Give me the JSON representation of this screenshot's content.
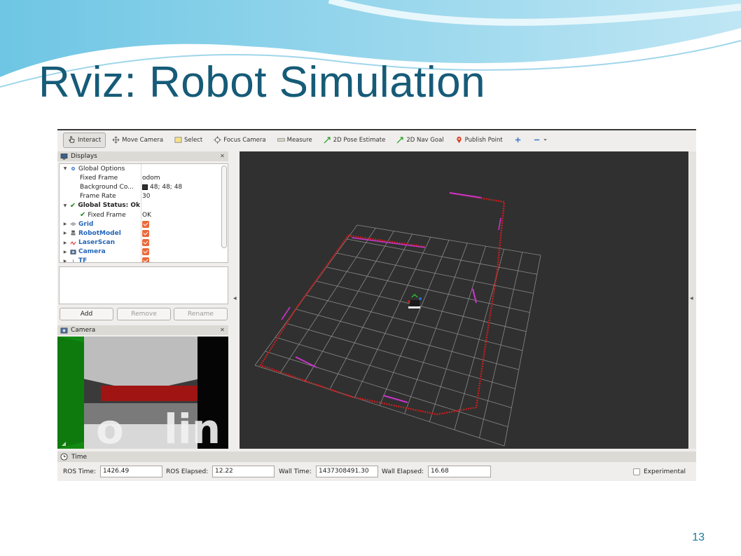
{
  "slide": {
    "title": "Rviz: Robot Simulation",
    "page_number": "13"
  },
  "toolbar": {
    "items": [
      {
        "label": "Interact",
        "icon": "hand-pointer-icon",
        "active": true
      },
      {
        "label": "Move Camera",
        "icon": "move-arrows-icon"
      },
      {
        "label": "Select",
        "icon": "select-rectangle-icon"
      },
      {
        "label": "Focus Camera",
        "icon": "focus-crosshair-icon"
      },
      {
        "label": "Measure",
        "icon": "ruler-icon"
      },
      {
        "label": "2D Pose Estimate",
        "icon": "green-arrow-icon"
      },
      {
        "label": "2D Nav Goal",
        "icon": "green-arrow-icon"
      },
      {
        "label": "Publish Point",
        "icon": "map-pin-icon"
      }
    ]
  },
  "displays": {
    "title": "Displays",
    "rows": [
      {
        "name": "Global Options",
        "value": ""
      },
      {
        "name": "Fixed Frame",
        "value": "odom"
      },
      {
        "name": "Background Co...",
        "value": "48; 48; 48"
      },
      {
        "name": "Frame Rate",
        "value": "30"
      },
      {
        "name": "Global Status: Ok",
        "value": ""
      },
      {
        "name": "Fixed Frame",
        "value": "OK"
      },
      {
        "name": "Grid",
        "value": ""
      },
      {
        "name": "RobotModel",
        "value": ""
      },
      {
        "name": "LaserScan",
        "value": ""
      },
      {
        "name": "Camera",
        "value": ""
      },
      {
        "name": "TF",
        "value": ""
      }
    ],
    "buttons": {
      "add": "Add",
      "remove": "Remove",
      "rename": "Rename"
    }
  },
  "camera_panel": {
    "title": "Camera"
  },
  "time_panel": {
    "title": "Time",
    "ros_time_label": "ROS Time:",
    "ros_time": "1426.49",
    "ros_elapsed_label": "ROS Elapsed:",
    "ros_elapsed": "12.22",
    "wall_time_label": "Wall Time:",
    "wall_time": "1437308491.30",
    "wall_elapsed_label": "Wall Elapsed:",
    "wall_elapsed": "16.68",
    "experimental_label": "Experimental"
  },
  "colors": {
    "title": "#165b78",
    "background_3d": "#303030",
    "laser_red": "#d21e1e",
    "laser_magenta": "#d033d0",
    "checkbox": "#e96a3a"
  }
}
